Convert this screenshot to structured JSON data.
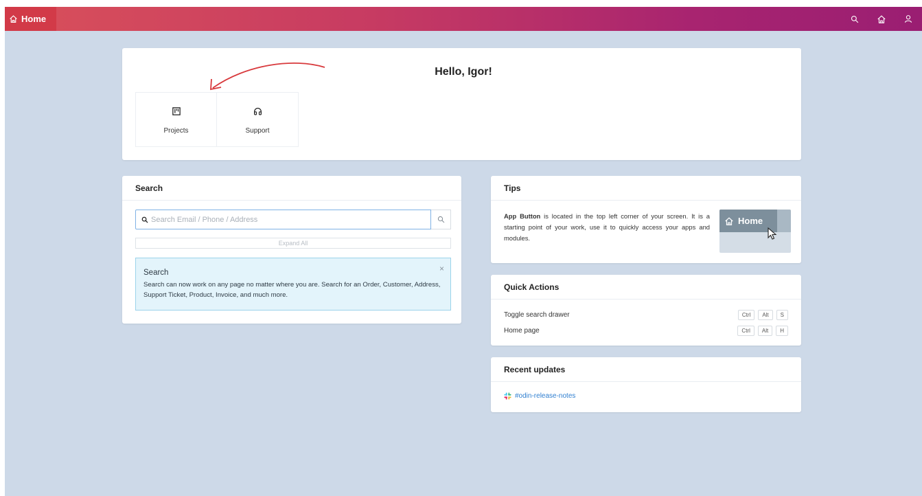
{
  "topbar": {
    "app_button_label": "Home",
    "icons": [
      "search-icon",
      "home-icon",
      "user-icon"
    ]
  },
  "hello": {
    "title": "Hello, Igor!",
    "tiles": [
      {
        "label": "Projects",
        "icon": "kanban-icon"
      },
      {
        "label": "Support",
        "icon": "headphones-icon"
      }
    ]
  },
  "search_card": {
    "title": "Search",
    "placeholder": "Search Email / Phone / Address",
    "expand_label": "Expand All",
    "alert": {
      "title": "Search",
      "body": "Search can now work on any page no matter where you are. Search for an Order, Customer, Address, Support Ticket, Product, Invoice, and much more.",
      "close": "×"
    }
  },
  "tips": {
    "title": "Tips",
    "bold": "App Button",
    "text": " is located in the top left corner of your screen. It is a starting point of your work, use it to quickly access your apps and modules.",
    "image_button_label": "Home"
  },
  "quick_actions": {
    "title": "Quick Actions",
    "items": [
      {
        "label": "Toggle search drawer",
        "keys": [
          "Ctrl",
          "Alt",
          "S"
        ]
      },
      {
        "label": "Home page",
        "keys": [
          "Ctrl",
          "Alt",
          "H"
        ]
      }
    ]
  },
  "recent_updates": {
    "title": "Recent updates",
    "link": "#odin-release-notes"
  },
  "colors": {
    "app_button": "#d23a48",
    "bar_start": "#d9505a",
    "bar_end": "#9a1e72",
    "page_bg": "#cdd9e8",
    "link": "#2f7fd0"
  }
}
